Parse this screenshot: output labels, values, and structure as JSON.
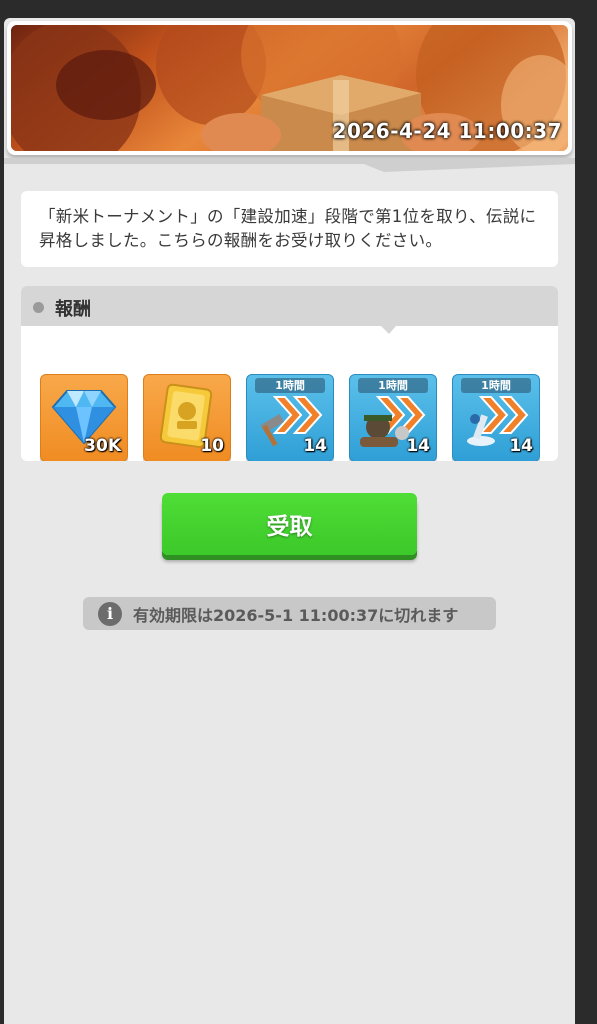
{
  "banner": {
    "timestamp": "2026-4-24 11:00:37"
  },
  "message": {
    "text": "「新米トーナメント」の「建設加速」段階で第1位を取り、伝説に昇格しました。こちらの報酬をお受け取りください。"
  },
  "rewards": {
    "title": "報酬",
    "items": [
      {
        "icon": "diamond-icon",
        "qty": "30K",
        "tag": ""
      },
      {
        "icon": "gold-card-icon",
        "qty": "10",
        "tag": ""
      },
      {
        "icon": "hammer-speedup-icon",
        "qty": "14",
        "tag": "1時間"
      },
      {
        "icon": "training-speedup-icon",
        "qty": "14",
        "tag": "1時間"
      },
      {
        "icon": "research-speedup-icon",
        "qty": "14",
        "tag": "1時間"
      }
    ]
  },
  "claim_button": {
    "label": "受取"
  },
  "expiry": {
    "text": "有効期限は2026-5-1 11:00:37に切れます"
  },
  "colors": {
    "panel_bg": "#e8e8e8",
    "claim_green": "#44d330",
    "orange_item": "#f4982f",
    "blue_item": "#3aa8dd"
  }
}
